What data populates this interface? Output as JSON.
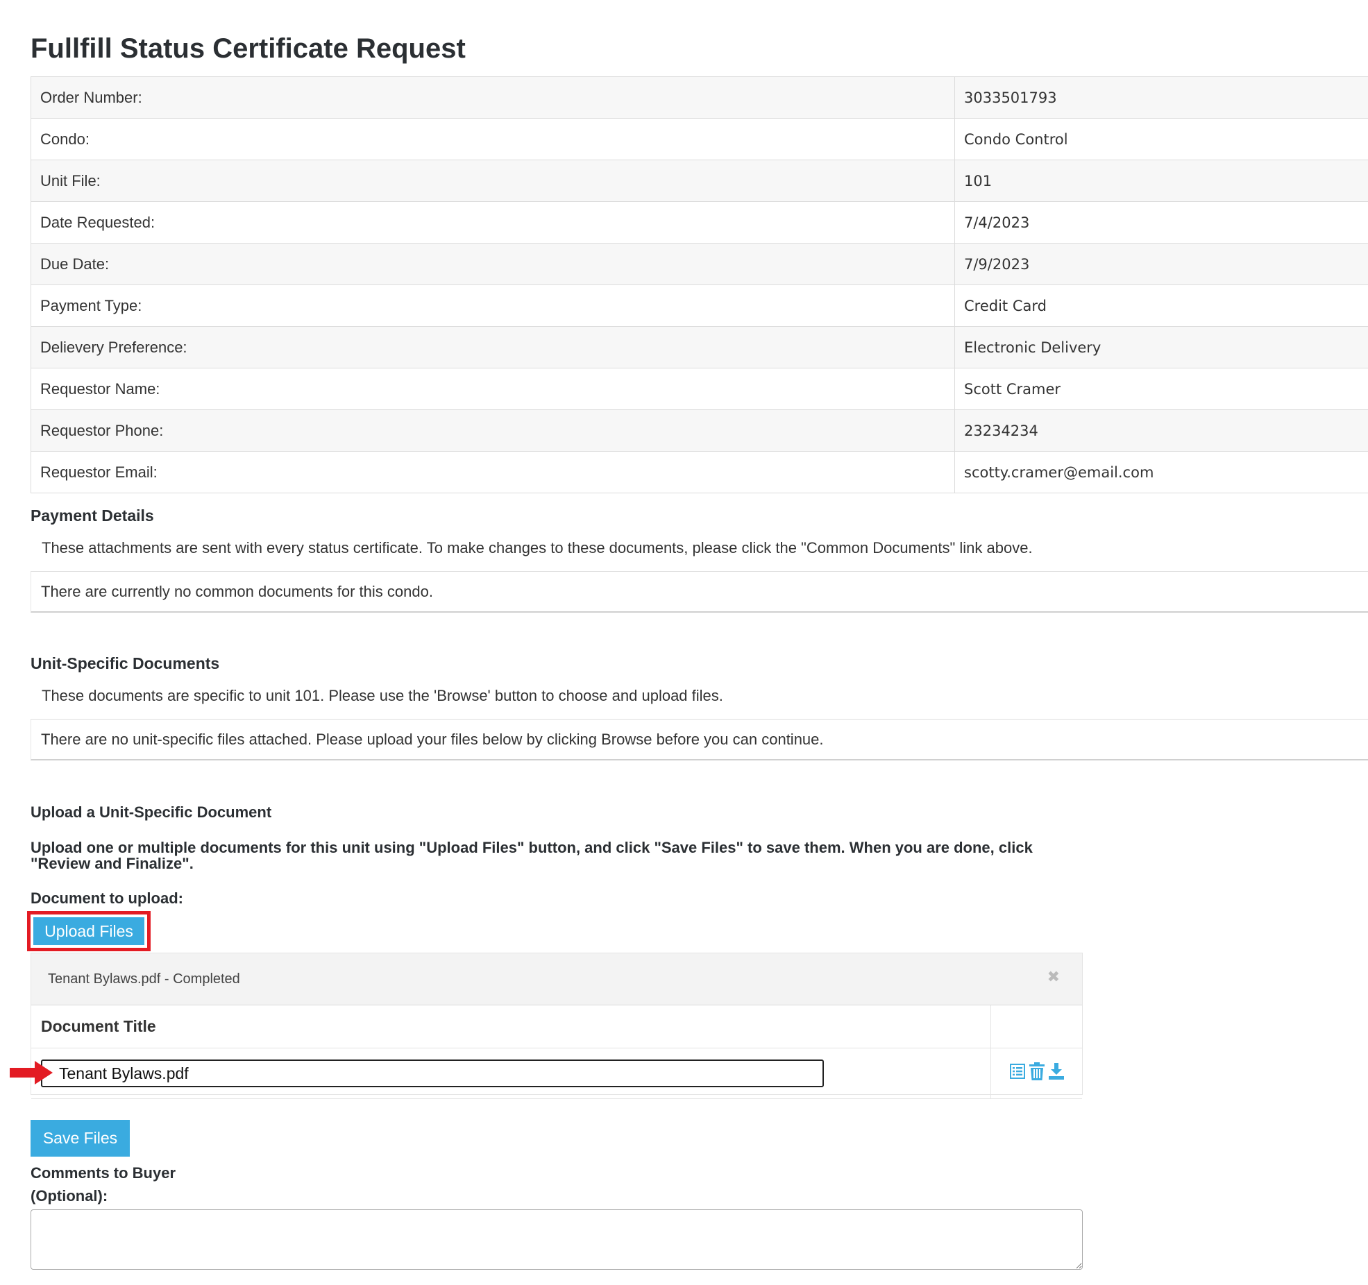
{
  "page": {
    "title": "Fullfill Status Certificate Request"
  },
  "order_details": [
    {
      "label": "Order Number:",
      "value": "3033501793"
    },
    {
      "label": "Condo:",
      "value": "Condo Control"
    },
    {
      "label": "Unit File:",
      "value": "101"
    },
    {
      "label": "Date Requested:",
      "value": "7/4/2023"
    },
    {
      "label": "Due Date:",
      "value": "7/9/2023"
    },
    {
      "label": "Payment Type:",
      "value": "Credit Card"
    },
    {
      "label": "Delievery Preference:",
      "value": "Electronic Delivery"
    },
    {
      "label": "Requestor Name:",
      "value": "Scott Cramer"
    },
    {
      "label": "Requestor Phone:",
      "value": "23234234"
    },
    {
      "label": "Requestor Email:",
      "value": "scotty.cramer@email.com"
    }
  ],
  "payment_details": {
    "heading": "Payment Details",
    "description": "These attachments are sent with every status certificate. To make changes to these documents, please click the \"Common Documents\" link above.",
    "notice": "There are currently no common documents for this condo."
  },
  "unit_documents": {
    "heading": "Unit-Specific Documents",
    "description": "These documents are specific to unit 101. Please use the 'Browse' button to choose and upload files.",
    "notice": "There are no unit-specific files attached. Please upload your files below by clicking Browse before you can continue."
  },
  "upload": {
    "heading": "Upload a Unit-Specific Document",
    "instructions": "Upload one or multiple documents for this unit using \"Upload Files\" button, and click \"Save Files\" to save them. When you are done, click \"Review and Finalize\".",
    "document_label": "Document to upload:",
    "upload_button": "Upload Files",
    "file_status": "Tenant Bylaws.pdf - Completed",
    "close_glyph": "✖",
    "table_header": "Document Title",
    "document_title_value": "Tenant Bylaws.pdf",
    "action_icons": [
      "list-icon",
      "trash-icon",
      "download-icon"
    ],
    "save_button": "Save Files"
  },
  "comments": {
    "label_line1": "Comments to Buyer",
    "label_line2": "(Optional):",
    "value": ""
  },
  "colors": {
    "button": "#3aabe0",
    "highlight": "#e31b23",
    "icon": "#3aabe0"
  }
}
